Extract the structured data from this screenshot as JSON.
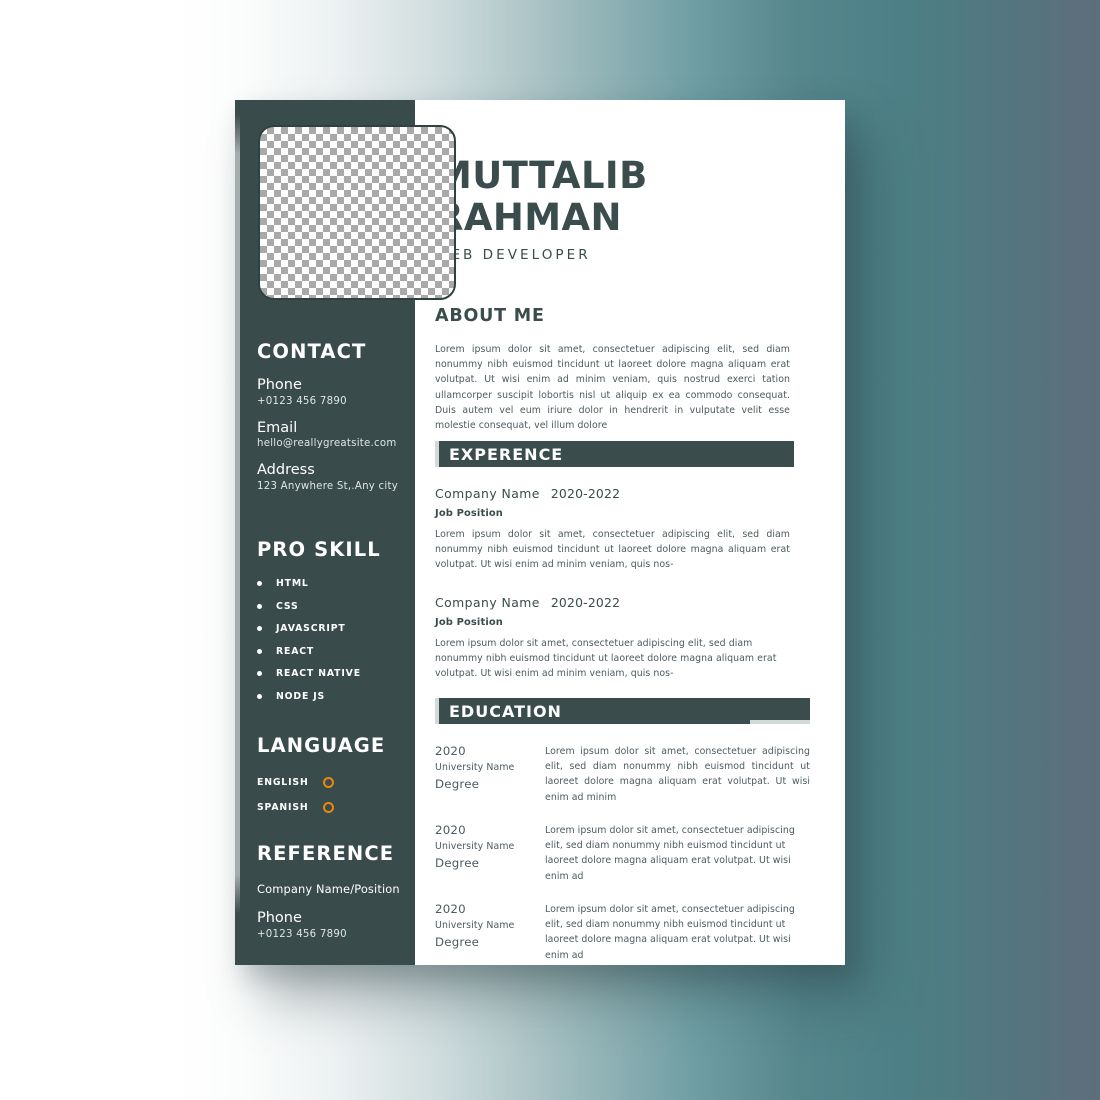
{
  "header": {
    "name_line1": "MUTTALIB",
    "name_line2": "RAHMAN",
    "role": "WEB DEVELOPER",
    "photo_placeholder": "checkerboard-transparent-image"
  },
  "colors": {
    "dark_panel": "#394b4a",
    "heading": "#3a4d4c",
    "body_text": "#4d5b60",
    "accent_orange": "#e8890c",
    "banner_accent": "#d3d8d8",
    "sheet": "#ffffff"
  },
  "sidebar": {
    "contact": {
      "heading": "CONTACT",
      "items": [
        {
          "label": "Phone",
          "value": "+0123 456 7890"
        },
        {
          "label": "Email",
          "value": "hello@reallygreatsite.com"
        },
        {
          "label": "Address",
          "value": "123 Anywhere St,.Any city"
        }
      ]
    },
    "pro_skill": {
      "heading": "PRO SKILL",
      "items": [
        "HTML",
        "CSS",
        "JAVASCRIPT",
        "REACT",
        "REACT NATIVE",
        "NODE JS"
      ]
    },
    "language": {
      "heading": "LANGUAGE",
      "items": [
        {
          "label": "ENGLISH",
          "marker": "ring-icon"
        },
        {
          "label": "SPANISH",
          "marker": "ring-icon"
        }
      ]
    },
    "reference": {
      "heading": "REFERENCE",
      "company_position": "Company Name/Position",
      "phone_label": "Phone",
      "phone_value": "+0123 456 7890"
    }
  },
  "main": {
    "about": {
      "heading": "ABOUT ME",
      "text": "Lorem ipsum dolor sit amet, consectetuer adipiscing elit, sed diam nonummy nibh euismod tincidunt ut laoreet dolore magna aliquam erat volutpat. Ut wisi enim ad minim veniam, quis nostrud exerci tation ullamcorper suscipit lobortis nisl ut aliquip ex ea commodo consequat. Duis autem vel eum iriure dolor in hendrerit in vulputate velit esse molestie consequat, vel illum dolore"
    },
    "experience": {
      "heading": "EXPERENCE",
      "entries": [
        {
          "company": "Company Name",
          "years": "2020-2022",
          "position": "Job Position",
          "text": "Lorem ipsum dolor sit amet, consectetuer adipiscing elit, sed diam nonummy nibh euismod tincidunt ut laoreet dolore magna aliquam erat volutpat. Ut wisi enim ad minim veniam, quis nos-"
        },
        {
          "company": "Company Name",
          "years": "2020-2022",
          "position": "Job Position",
          "text": "Lorem ipsum dolor sit amet, consectetuer adipiscing elit, sed diam nonummy nibh euismod tincidunt ut laoreet dolore magna aliquam erat volutpat. Ut wisi enim ad minim veniam, quis nos-"
        }
      ]
    },
    "education": {
      "heading": "EDUCATION",
      "entries": [
        {
          "year": "2020",
          "university": "University Name",
          "degree": "Degree",
          "text": "Lorem ipsum dolor sit amet, consectetuer adipiscing elit, sed diam nonummy nibh euismod tincidunt ut laoreet dolore magna aliquam erat volutpat. Ut wisi enim ad minim"
        },
        {
          "year": "2020",
          "university": "University Name",
          "degree": "Degree",
          "text": "Lorem ipsum dolor sit amet, consectetuer adipiscing elit, sed diam nonummy nibh euismod tincidunt ut laoreet dolore magna aliquam erat volutpat. Ut wisi enim ad"
        },
        {
          "year": "2020",
          "university": "University Name",
          "degree": "Degree",
          "text": "Lorem ipsum dolor sit amet, consectetuer adipiscing elit, sed diam nonummy nibh euismod tincidunt ut laoreet dolore magna aliquam erat volutpat. Ut wisi enim ad"
        }
      ]
    }
  }
}
